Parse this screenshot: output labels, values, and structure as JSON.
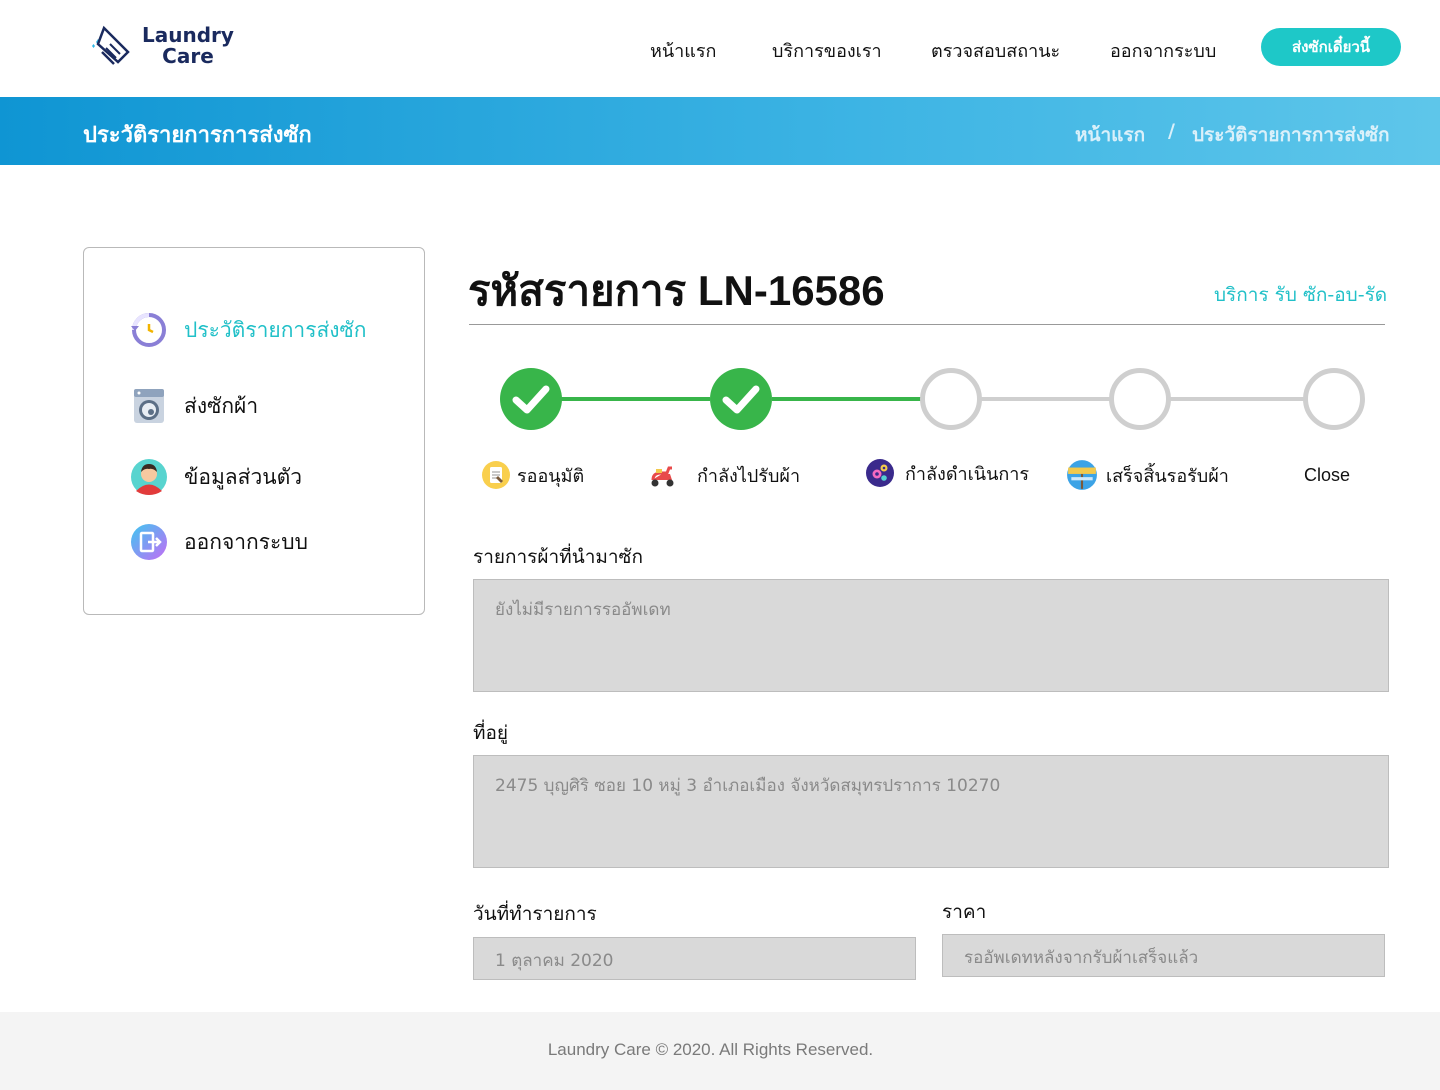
{
  "brand": {
    "line1": "Laundry",
    "line2": "Care"
  },
  "nav": {
    "items": [
      "หน้าแรก",
      "บริการของเรา",
      "ตรวจสอบสถานะ",
      "ออกจากระบบ"
    ],
    "cta_label": "ส่งซักเดี๋ยวนี้"
  },
  "banner": {
    "title": "ประวัติรายการการส่งซัก",
    "breadcrumb_home": "หน้าแรก",
    "breadcrumb_sep": "/",
    "breadcrumb_current": "ประวัติรายการการส่งซัก"
  },
  "sidebar": {
    "items": [
      {
        "label": "ประวัติรายการส่งซัก",
        "icon": "history-icon",
        "active": true
      },
      {
        "label": "ส่งซักผ้า",
        "icon": "washing-machine-icon",
        "active": false
      },
      {
        "label": "ข้อมูลส่วนตัว",
        "icon": "user-profile-icon",
        "active": false
      },
      {
        "label": "ออกจากระบบ",
        "icon": "logout-icon",
        "active": false
      }
    ]
  },
  "order": {
    "title": "รหัสรายการ LN-16586",
    "service": "บริการ รับ ซัก-อบ-รัด"
  },
  "steps": [
    {
      "label": "รออนุมัติ",
      "icon": "clipboard-icon",
      "status": "done"
    },
    {
      "label": "กำลังไปรับผ้า",
      "icon": "scooter-icon",
      "status": "done"
    },
    {
      "label": "กำลังดำเนินการ",
      "icon": "gears-icon",
      "status": "pending"
    },
    {
      "label": "เสร็จสิ้นรอรับผ้า",
      "icon": "success-sign-icon",
      "status": "pending"
    },
    {
      "label": "Close",
      "icon": "",
      "status": "pending"
    }
  ],
  "colors": {
    "accent": "#21c0c8",
    "done": "#38b54a",
    "pending": "#cfcfcf",
    "banner": "#0f95d3"
  },
  "fields": {
    "items_label": "รายการผ้าที่นำมาซัก",
    "items_value": "ยังไม่มีรายการรออัพเดท",
    "address_label": "ที่อยู่",
    "address_value": "2475 บุญศิริ ซอย 10 หมู่ 3 อำเภอเมือง จังหวัดสมุทรปราการ 10270",
    "date_label": "วันที่ทำรายการ",
    "date_value": "1 ตุลาคม 2020",
    "price_label": "ราคา",
    "price_value": "รออัพเดทหลังจากรับผ้าเสร็จแล้ว"
  },
  "footer": {
    "text": "Laundry Care © 2020. All Rights Reserved."
  }
}
